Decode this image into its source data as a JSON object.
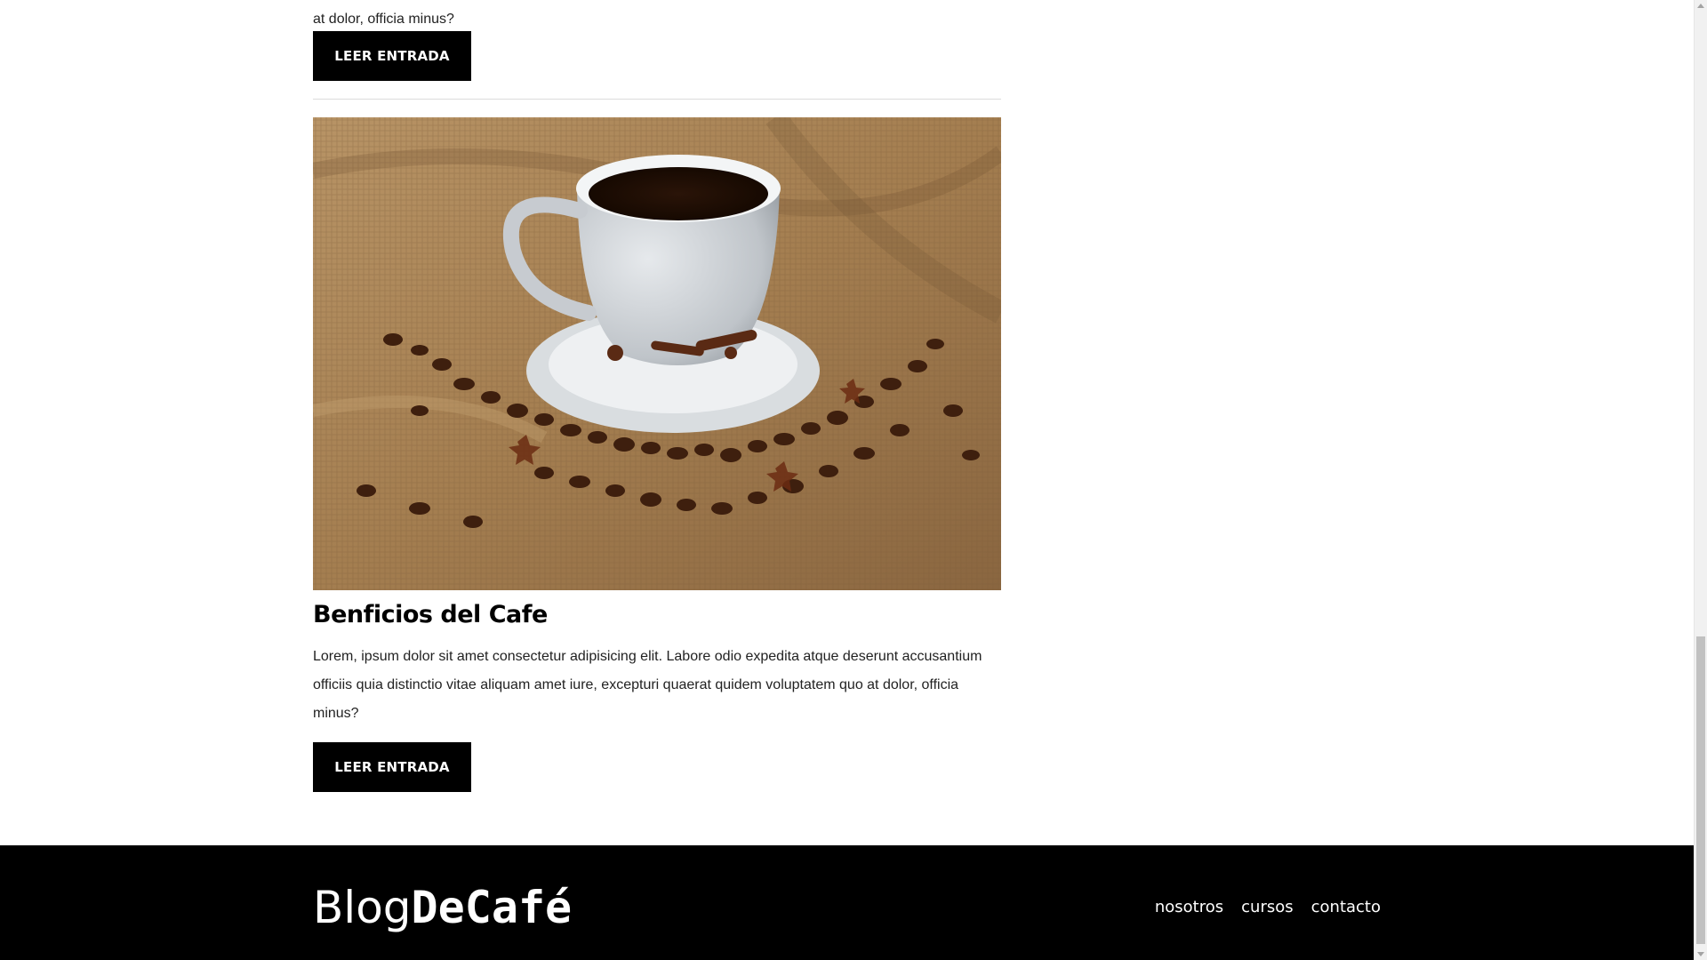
{
  "post_prev": {
    "excerpt_tail": "at dolor, officia minus?",
    "button_label": "LEER ENTRADA"
  },
  "post": {
    "title": "Benficios del Cafe",
    "excerpt": "Lorem, ipsum dolor sit amet consectetur adipisicing elit. Labore odio expedita atque deserunt accusantium officiis quia distinctio vitae aliquam amet iure, excepturi quaerat quidem voluptatem quo at dolor, officia minus?",
    "button_label": "LEER ENTRADA",
    "image": "coffee-cup-with-beans-photo"
  },
  "footer": {
    "logo_light": "Blog",
    "logo_bold": "DeCafé",
    "nav": [
      "nosotros",
      "cursos",
      "contacto"
    ]
  },
  "colors": {
    "background": "#ffffff",
    "button": "#000000",
    "footer": "#000000",
    "text": "#222222"
  }
}
